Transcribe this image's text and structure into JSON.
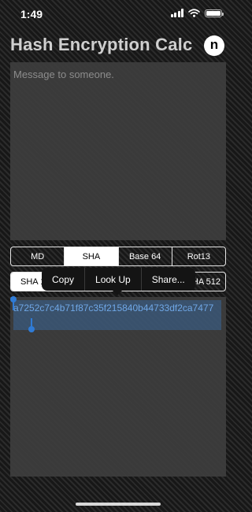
{
  "status_bar": {
    "time": "1:49"
  },
  "header": {
    "title": "Hash Encryption Calc",
    "logo_letter": "n"
  },
  "message": {
    "placeholder": "Message to someone.",
    "value": ""
  },
  "algorithm_tabs": [
    {
      "label": "MD",
      "selected": false
    },
    {
      "label": "SHA",
      "selected": true
    },
    {
      "label": "Base 64",
      "selected": false
    },
    {
      "label": "Rot13",
      "selected": false
    }
  ],
  "variant_tabs": [
    {
      "label": "SHA 1",
      "selected": true
    },
    {
      "label": "HA 512",
      "selected": false
    }
  ],
  "context_menu": {
    "copy": "Copy",
    "look_up": "Look Up",
    "share": "Share..."
  },
  "result": {
    "hash": "a7252c7c4b71f87c35f215840b44733df2ca7477"
  },
  "colors": {
    "accent": "#2f7bd6",
    "hash_text": "#6fa7e6",
    "field_bg": "#3e3e3e"
  },
  "icons": [
    "cellular-signal-icon",
    "wifi-icon",
    "battery-icon",
    "app-logo-icon"
  ]
}
